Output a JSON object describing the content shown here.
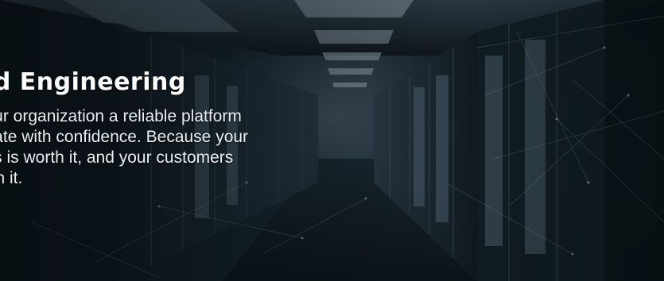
{
  "hero": {
    "title": "ud Engineering",
    "body": "your organization a reliable platform\novate with confidence. Because your\ness is worth it, and your customers\north it."
  },
  "colors": {
    "title": "#ffffff",
    "body": "#e9eef2",
    "background": "#0b1218"
  }
}
